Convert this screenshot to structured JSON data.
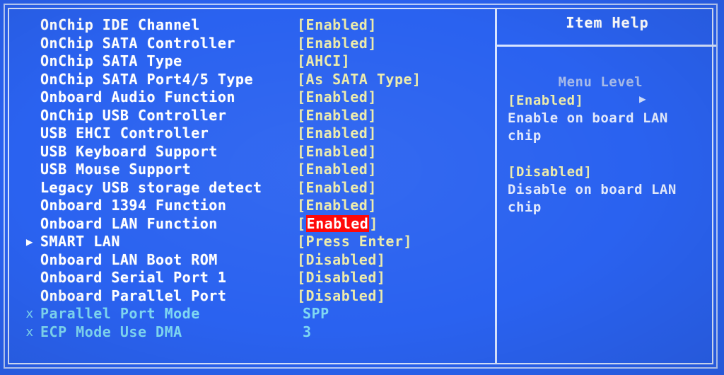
{
  "screen": {
    "background_color": "#2a62f0",
    "frame_color": "#d8e4ff",
    "label_color": "#ffffff",
    "value_color": "#ecebaa",
    "dim_color": "#7fd8f2",
    "highlight_bg_color": "#ff0000",
    "highlight_fg_color": "#ffffff"
  },
  "menu": {
    "items": [
      {
        "marker": "",
        "label": "OnChip IDE Channel",
        "value": "[Enabled]",
        "state": "normal"
      },
      {
        "marker": "",
        "label": "OnChip SATA Controller",
        "value": "[Enabled]",
        "state": "normal"
      },
      {
        "marker": "",
        "label": "OnChip SATA Type",
        "value": "[AHCI]",
        "state": "normal"
      },
      {
        "marker": "",
        "label": "OnChip SATA Port4/5 Type",
        "value": "[As SATA Type]",
        "state": "normal"
      },
      {
        "marker": "",
        "label": "Onboard Audio Function",
        "value": "[Enabled]",
        "state": "normal"
      },
      {
        "marker": "",
        "label": "OnChip USB Controller",
        "value": "[Enabled]",
        "state": "normal"
      },
      {
        "marker": "",
        "label": "USB EHCI Controller",
        "value": "[Enabled]",
        "state": "normal"
      },
      {
        "marker": "",
        "label": "USB Keyboard Support",
        "value": "[Enabled]",
        "state": "normal"
      },
      {
        "marker": "",
        "label": "USB Mouse Support",
        "value": "[Enabled]",
        "state": "normal"
      },
      {
        "marker": "",
        "label": "Legacy USB storage detect",
        "value": "[Enabled]",
        "state": "normal"
      },
      {
        "marker": "",
        "label": "Onboard 1394 Function",
        "value": "[Enabled]",
        "state": "normal"
      },
      {
        "marker": "",
        "label": "Onboard LAN Function",
        "value": "[Enabled]",
        "state": "selected",
        "value_inner": "Enabled"
      },
      {
        "marker": "▶",
        "label": "SMART LAN",
        "value": "[Press Enter]",
        "state": "submenu"
      },
      {
        "marker": "",
        "label": "Onboard LAN Boot ROM",
        "value": "[Disabled]",
        "state": "normal"
      },
      {
        "marker": "",
        "label": "Onboard Serial Port 1",
        "value": "[Disabled]",
        "state": "normal"
      },
      {
        "marker": "",
        "label": "Onboard Parallel Port",
        "value": "[Disabled]",
        "state": "normal"
      },
      {
        "marker": "x",
        "label": "Parallel Port Mode",
        "value": "SPP",
        "state": "disabled"
      },
      {
        "marker": "x",
        "label": "ECP Mode Use DMA",
        "value": "3",
        "state": "disabled"
      }
    ]
  },
  "help": {
    "title": "Item Help",
    "menu_level_label": "Menu Level",
    "menu_level_arrow": "▶",
    "entries": [
      {
        "key": "[Enabled]",
        "desc_line1": "Enable on board LAN",
        "desc_line2": "chip"
      },
      {
        "key": "[Disabled]",
        "desc_line1": "Disable on board LAN",
        "desc_line2": "chip"
      }
    ]
  }
}
